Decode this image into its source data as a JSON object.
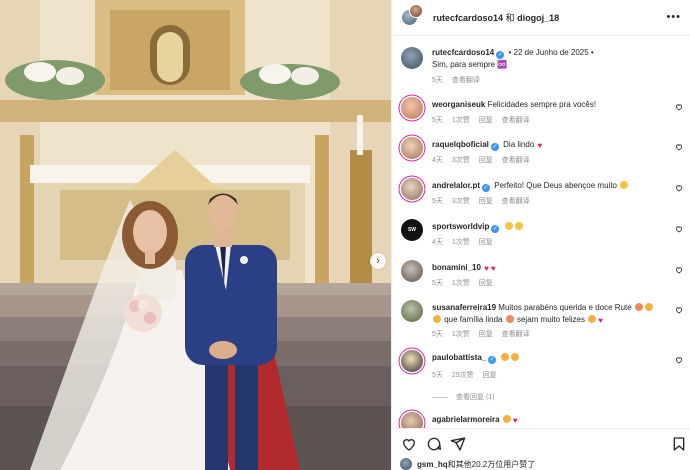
{
  "header": {
    "user1": "rutecfcardoso14",
    "conjunction": "和",
    "user2": "diogoj_18"
  },
  "caption": {
    "username": "rutecfcardoso14",
    "date": "22 de Junho de 2025",
    "text": "Sim, para sempre",
    "emoji": "♾️",
    "age": "5天",
    "translate": "查看翻译"
  },
  "comments": [
    {
      "username": "weorganiseuk",
      "verified": false,
      "text": "Felicidades sempre pra vocês!",
      "age": "5天",
      "likes": "1次赞",
      "reply": "回复",
      "translate": "查看翻译"
    },
    {
      "username": "raquelqboficial",
      "verified": true,
      "text": "Dia lindo",
      "age": "4天",
      "likes": "3次赞",
      "reply": "回复",
      "translate": "查看翻译"
    },
    {
      "username": "andrelalor.pt",
      "verified": true,
      "text": "Perfeito! Que Deus abençoe muito",
      "age": "5天",
      "likes": "3次赞",
      "reply": "回复",
      "translate": "查看翻译"
    },
    {
      "username": "sportsworldvip",
      "verified": true,
      "text": "",
      "age": "4天",
      "likes": "1次赞",
      "reply": "回复"
    },
    {
      "username": "bonamini_10",
      "verified": false,
      "text": "",
      "age": "5天",
      "likes": "1次赞",
      "reply": "回复"
    },
    {
      "username": "susanaferreira19",
      "verified": false,
      "text": "Muitos parabéns querida e doce Rute",
      "text2a": "que família linda",
      "text2b": "sejam muito felizes",
      "age": "5天",
      "likes": "1次赞",
      "reply": "回复",
      "translate": "查看翻译"
    },
    {
      "username": "paulobattista_",
      "verified": true,
      "text": "",
      "age": "5天",
      "likes": "29次赞",
      "reply": "回复",
      "view_replies": "查看回复 (1)"
    },
    {
      "username": "agabrielarmoreira",
      "verified": false,
      "text": ""
    }
  ],
  "likes_summary": {
    "prefix": "gsm_hq",
    "suffix": "和其他20.2万位用户赞了"
  },
  "icons": [
    "heart-icon",
    "comment-icon",
    "share-icon",
    "bookmark-icon",
    "more-icon",
    "verified-icon",
    "chevron-right-icon"
  ],
  "colors": {
    "verified": "#3897f0",
    "heart": "#e0245e",
    "muted": "#8e8e8e",
    "text": "#262626"
  }
}
